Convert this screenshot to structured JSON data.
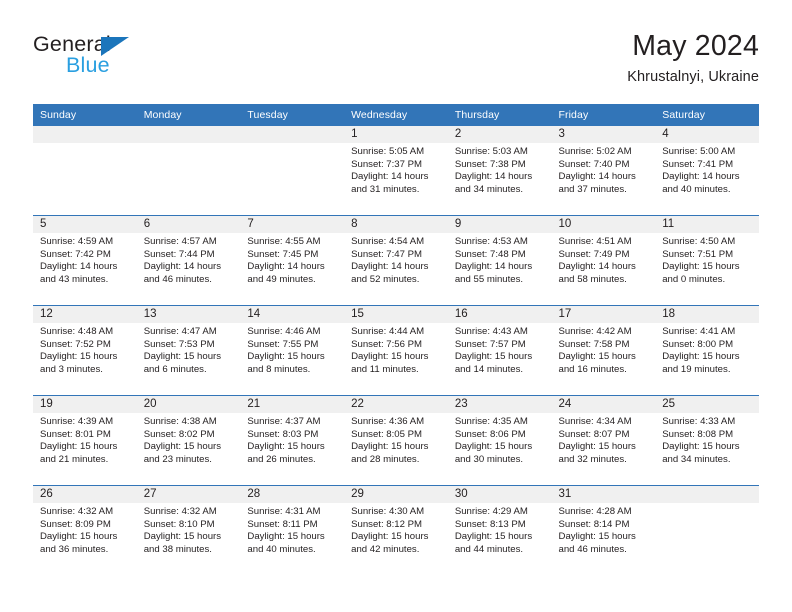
{
  "brand": {
    "word_one": "General",
    "word_two": "Blue",
    "triangle_color": "#1b75bb",
    "blue_color": "#2a9fe0"
  },
  "header": {
    "month_title": "May 2024",
    "location": "Khrustalnyi, Ukraine",
    "header_bg": "#3275b8",
    "daynum_bg": "#f0f0f0"
  },
  "weekday_headers": [
    "Sunday",
    "Monday",
    "Tuesday",
    "Wednesday",
    "Thursday",
    "Friday",
    "Saturday"
  ],
  "labels": {
    "sunrise_prefix": "Sunrise:",
    "sunset_prefix": "Sunset:",
    "daylight_prefix": "Daylight:"
  },
  "weeks": [
    [
      {
        "day": "",
        "line1": "",
        "line2": "",
        "line3": "",
        "line4": "",
        "empty": true
      },
      {
        "day": "",
        "line1": "",
        "line2": "",
        "line3": "",
        "line4": "",
        "empty": true
      },
      {
        "day": "",
        "line1": "",
        "line2": "",
        "line3": "",
        "line4": "",
        "empty": true
      },
      {
        "day": "1",
        "line1": "Sunrise: 5:05 AM",
        "line2": "Sunset: 7:37 PM",
        "line3": "Daylight: 14 hours",
        "line4": "and 31 minutes.",
        "empty": false
      },
      {
        "day": "2",
        "line1": "Sunrise: 5:03 AM",
        "line2": "Sunset: 7:38 PM",
        "line3": "Daylight: 14 hours",
        "line4": "and 34 minutes.",
        "empty": false
      },
      {
        "day": "3",
        "line1": "Sunrise: 5:02 AM",
        "line2": "Sunset: 7:40 PM",
        "line3": "Daylight: 14 hours",
        "line4": "and 37 minutes.",
        "empty": false
      },
      {
        "day": "4",
        "line1": "Sunrise: 5:00 AM",
        "line2": "Sunset: 7:41 PM",
        "line3": "Daylight: 14 hours",
        "line4": "and 40 minutes.",
        "empty": false
      }
    ],
    [
      {
        "day": "5",
        "line1": "Sunrise: 4:59 AM",
        "line2": "Sunset: 7:42 PM",
        "line3": "Daylight: 14 hours",
        "line4": "and 43 minutes.",
        "empty": false
      },
      {
        "day": "6",
        "line1": "Sunrise: 4:57 AM",
        "line2": "Sunset: 7:44 PM",
        "line3": "Daylight: 14 hours",
        "line4": "and 46 minutes.",
        "empty": false
      },
      {
        "day": "7",
        "line1": "Sunrise: 4:55 AM",
        "line2": "Sunset: 7:45 PM",
        "line3": "Daylight: 14 hours",
        "line4": "and 49 minutes.",
        "empty": false
      },
      {
        "day": "8",
        "line1": "Sunrise: 4:54 AM",
        "line2": "Sunset: 7:47 PM",
        "line3": "Daylight: 14 hours",
        "line4": "and 52 minutes.",
        "empty": false
      },
      {
        "day": "9",
        "line1": "Sunrise: 4:53 AM",
        "line2": "Sunset: 7:48 PM",
        "line3": "Daylight: 14 hours",
        "line4": "and 55 minutes.",
        "empty": false
      },
      {
        "day": "10",
        "line1": "Sunrise: 4:51 AM",
        "line2": "Sunset: 7:49 PM",
        "line3": "Daylight: 14 hours",
        "line4": "and 58 minutes.",
        "empty": false
      },
      {
        "day": "11",
        "line1": "Sunrise: 4:50 AM",
        "line2": "Sunset: 7:51 PM",
        "line3": "Daylight: 15 hours",
        "line4": "and 0 minutes.",
        "empty": false
      }
    ],
    [
      {
        "day": "12",
        "line1": "Sunrise: 4:48 AM",
        "line2": "Sunset: 7:52 PM",
        "line3": "Daylight: 15 hours",
        "line4": "and 3 minutes.",
        "empty": false
      },
      {
        "day": "13",
        "line1": "Sunrise: 4:47 AM",
        "line2": "Sunset: 7:53 PM",
        "line3": "Daylight: 15 hours",
        "line4": "and 6 minutes.",
        "empty": false
      },
      {
        "day": "14",
        "line1": "Sunrise: 4:46 AM",
        "line2": "Sunset: 7:55 PM",
        "line3": "Daylight: 15 hours",
        "line4": "and 8 minutes.",
        "empty": false
      },
      {
        "day": "15",
        "line1": "Sunrise: 4:44 AM",
        "line2": "Sunset: 7:56 PM",
        "line3": "Daylight: 15 hours",
        "line4": "and 11 minutes.",
        "empty": false
      },
      {
        "day": "16",
        "line1": "Sunrise: 4:43 AM",
        "line2": "Sunset: 7:57 PM",
        "line3": "Daylight: 15 hours",
        "line4": "and 14 minutes.",
        "empty": false
      },
      {
        "day": "17",
        "line1": "Sunrise: 4:42 AM",
        "line2": "Sunset: 7:58 PM",
        "line3": "Daylight: 15 hours",
        "line4": "and 16 minutes.",
        "empty": false
      },
      {
        "day": "18",
        "line1": "Sunrise: 4:41 AM",
        "line2": "Sunset: 8:00 PM",
        "line3": "Daylight: 15 hours",
        "line4": "and 19 minutes.",
        "empty": false
      }
    ],
    [
      {
        "day": "19",
        "line1": "Sunrise: 4:39 AM",
        "line2": "Sunset: 8:01 PM",
        "line3": "Daylight: 15 hours",
        "line4": "and 21 minutes.",
        "empty": false
      },
      {
        "day": "20",
        "line1": "Sunrise: 4:38 AM",
        "line2": "Sunset: 8:02 PM",
        "line3": "Daylight: 15 hours",
        "line4": "and 23 minutes.",
        "empty": false
      },
      {
        "day": "21",
        "line1": "Sunrise: 4:37 AM",
        "line2": "Sunset: 8:03 PM",
        "line3": "Daylight: 15 hours",
        "line4": "and 26 minutes.",
        "empty": false
      },
      {
        "day": "22",
        "line1": "Sunrise: 4:36 AM",
        "line2": "Sunset: 8:05 PM",
        "line3": "Daylight: 15 hours",
        "line4": "and 28 minutes.",
        "empty": false
      },
      {
        "day": "23",
        "line1": "Sunrise: 4:35 AM",
        "line2": "Sunset: 8:06 PM",
        "line3": "Daylight: 15 hours",
        "line4": "and 30 minutes.",
        "empty": false
      },
      {
        "day": "24",
        "line1": "Sunrise: 4:34 AM",
        "line2": "Sunset: 8:07 PM",
        "line3": "Daylight: 15 hours",
        "line4": "and 32 minutes.",
        "empty": false
      },
      {
        "day": "25",
        "line1": "Sunrise: 4:33 AM",
        "line2": "Sunset: 8:08 PM",
        "line3": "Daylight: 15 hours",
        "line4": "and 34 minutes.",
        "empty": false
      }
    ],
    [
      {
        "day": "26",
        "line1": "Sunrise: 4:32 AM",
        "line2": "Sunset: 8:09 PM",
        "line3": "Daylight: 15 hours",
        "line4": "and 36 minutes.",
        "empty": false
      },
      {
        "day": "27",
        "line1": "Sunrise: 4:32 AM",
        "line2": "Sunset: 8:10 PM",
        "line3": "Daylight: 15 hours",
        "line4": "and 38 minutes.",
        "empty": false
      },
      {
        "day": "28",
        "line1": "Sunrise: 4:31 AM",
        "line2": "Sunset: 8:11 PM",
        "line3": "Daylight: 15 hours",
        "line4": "and 40 minutes.",
        "empty": false
      },
      {
        "day": "29",
        "line1": "Sunrise: 4:30 AM",
        "line2": "Sunset: 8:12 PM",
        "line3": "Daylight: 15 hours",
        "line4": "and 42 minutes.",
        "empty": false
      },
      {
        "day": "30",
        "line1": "Sunrise: 4:29 AM",
        "line2": "Sunset: 8:13 PM",
        "line3": "Daylight: 15 hours",
        "line4": "and 44 minutes.",
        "empty": false
      },
      {
        "day": "31",
        "line1": "Sunrise: 4:28 AM",
        "line2": "Sunset: 8:14 PM",
        "line3": "Daylight: 15 hours",
        "line4": "and 46 minutes.",
        "empty": false
      },
      {
        "day": "",
        "line1": "",
        "line2": "",
        "line3": "",
        "line4": "",
        "empty": true
      }
    ]
  ]
}
